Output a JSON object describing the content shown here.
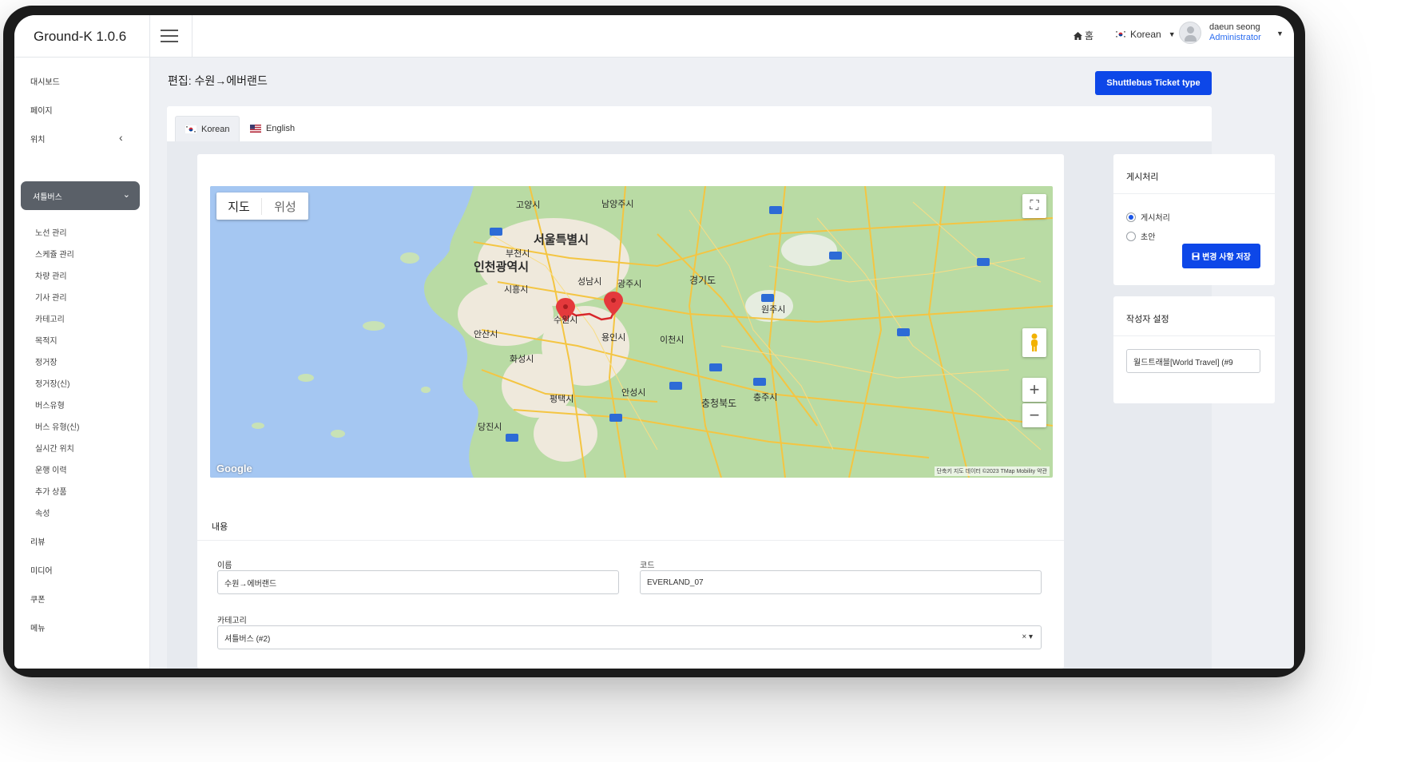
{
  "app": {
    "title": "Ground-K 1.0.6"
  },
  "header": {
    "home_label": "홈",
    "language": "Korean",
    "user_name": "daeun seong",
    "user_role": "Administrator"
  },
  "sidebar": {
    "items": [
      {
        "label": "대시보드"
      },
      {
        "label": "페이지"
      },
      {
        "label": "위치"
      },
      {
        "label": "셔틀버스"
      },
      {
        "label": "리뷰"
      },
      {
        "label": "미디어"
      },
      {
        "label": "쿠폰"
      },
      {
        "label": "메뉴"
      }
    ],
    "sub_items": [
      "노선 관리",
      "스케쥴 관리",
      "차량 관리",
      "기사 관리",
      "카테고리",
      "목적지",
      "정거장",
      "정거장(신)",
      "버스유형",
      "버스 유형(신)",
      "실시간 위치",
      "운행 이력",
      "추가 상품",
      "속성"
    ]
  },
  "page": {
    "title": "편집: 수원→에버랜드",
    "ticket_button": "Shuttlebus Ticket type"
  },
  "tabs": [
    {
      "label": "Korean",
      "icon": "korea-flag-icon"
    },
    {
      "label": "English",
      "icon": "us-flag-icon"
    }
  ],
  "map": {
    "mode_map": "지도",
    "mode_satellite": "위성",
    "logo": "Google",
    "attribution": "단축키  지도 데이터 ©2023 TMap Mobility  약관",
    "labels": [
      "고양시",
      "남양주시",
      "서울특별시",
      "부천시",
      "인천광역시",
      "시흥시",
      "성남시",
      "광주시",
      "경기도",
      "수원시",
      "용인시",
      "안산시",
      "화성시",
      "이천시",
      "원주시",
      "평택시",
      "안성시",
      "충주시",
      "충청북도",
      "당진시"
    ],
    "colors": {
      "land": "#b9dba4",
      "water": "#a5c7f2",
      "road": "#f4c542",
      "route": "#d8262a",
      "urban": "#f0ede5"
    }
  },
  "content": {
    "section_title": "내용",
    "name_label": "이름",
    "name_value": "수원→에버랜드",
    "code_label": "코드",
    "code_value": "EVERLAND_07",
    "category_label": "카테고리",
    "category_value": "셔틀버스 (#2)"
  },
  "publish": {
    "title": "게시처리",
    "option_publish": "게시처리",
    "option_draft": "초안",
    "save_label": "변경 사항 저장"
  },
  "author": {
    "title": "작성자 설정",
    "value": "월드트래블[World Travel] (#9"
  },
  "colors": {
    "accent": "#0d47e8",
    "sidebar_active": "#5a6068"
  }
}
